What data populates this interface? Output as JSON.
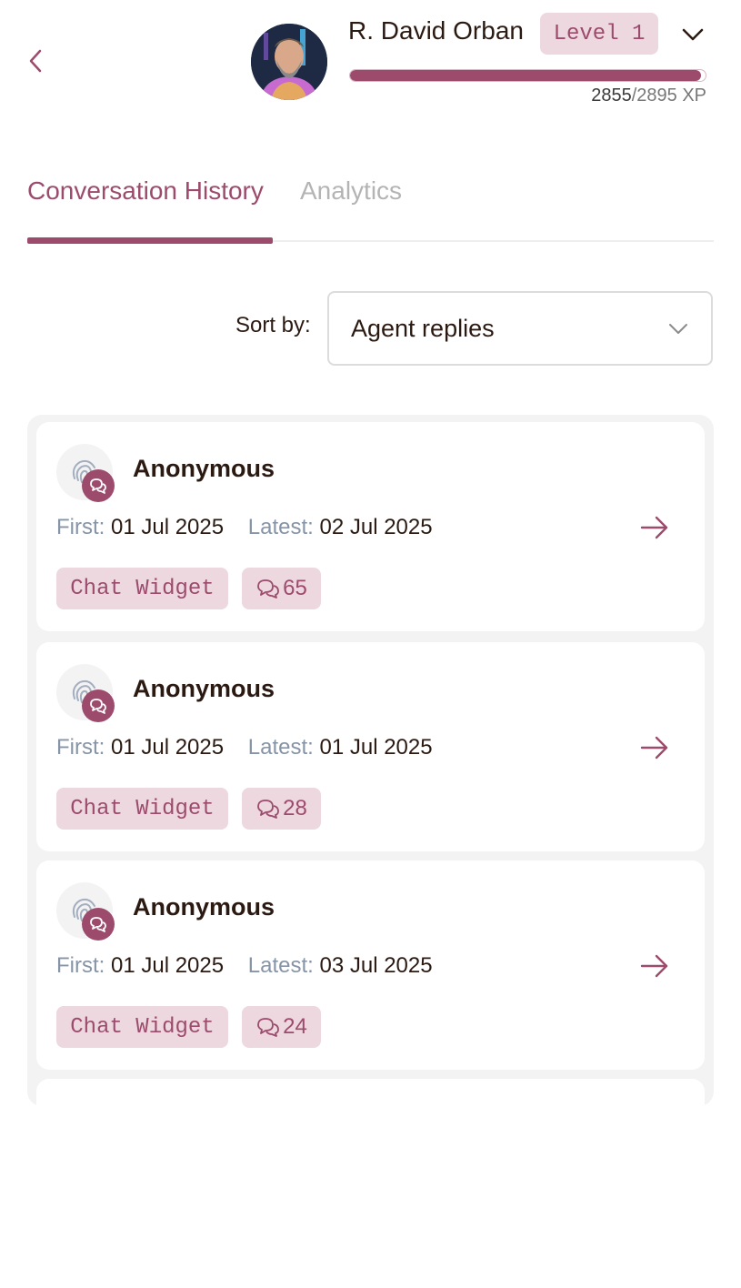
{
  "header": {
    "user_name": "R. David Orban",
    "level": "Level 1",
    "xp_current": "2855",
    "xp_separator": "/",
    "xp_total": "2895 XP",
    "xp_progress": 0.986
  },
  "tabs": [
    {
      "label": "Conversation History",
      "active": true
    },
    {
      "label": "Analytics",
      "active": false
    }
  ],
  "sort": {
    "label": "Sort by:",
    "value": "Agent replies"
  },
  "conversations": [
    {
      "name": "Anonymous",
      "first_label": "First:",
      "first": "01 Jul 2025",
      "latest_label": "Latest:",
      "latest": "02 Jul 2025",
      "source": "Chat Widget",
      "messages": "65"
    },
    {
      "name": "Anonymous",
      "first_label": "First:",
      "first": "01 Jul 2025",
      "latest_label": "Latest:",
      "latest": "01 Jul 2025",
      "source": "Chat Widget",
      "messages": "28"
    },
    {
      "name": "Anonymous",
      "first_label": "First:",
      "first": "01 Jul 2025",
      "latest_label": "Latest:",
      "latest": "03 Jul 2025",
      "source": "Chat Widget",
      "messages": "24"
    }
  ],
  "icons": {
    "back": "chevron-left-icon",
    "account_menu": "chevron-down-icon",
    "sort_dropdown": "chevron-down-icon",
    "visitor": "fingerprint-icon",
    "channel": "chat-bubbles-icon",
    "open": "arrow-right-icon",
    "message_count": "chat-bubbles-icon"
  },
  "colors": {
    "accent": "#9c4b6c",
    "tag_bg": "#eed8df",
    "panel_bg": "#f3f3f4",
    "muted_label": "#8694a7"
  }
}
